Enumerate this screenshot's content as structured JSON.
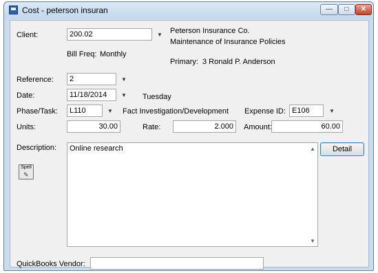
{
  "window": {
    "title": "Cost - peterson insuran",
    "min_icon": "minimize-icon",
    "max_icon": "maximize-icon",
    "close_icon": "close-icon"
  },
  "form": {
    "client_label": "Client:",
    "client_value": "200.02",
    "client_name": "Peterson Insurance Co.",
    "client_matter": "Maintenance of Insurance Policies",
    "bill_freq_label": "Bill Freq:",
    "bill_freq_value": "Monthly",
    "primary_label": "Primary:",
    "primary_value": "3  Ronald P. Anderson",
    "reference_label": "Reference:",
    "reference_value": "2",
    "date_label": "Date:",
    "date_value": "11/18/2014",
    "date_day": "Tuesday",
    "phase_label": "Phase/Task:",
    "phase_value": "L110",
    "phase_desc": "Fact Investigation/Development",
    "expense_label": "Expense ID:",
    "expense_value": "E106",
    "units_label": "Units:",
    "units_value": "30.00",
    "rate_label": "Rate:",
    "rate_value": "2.000",
    "amount_label": "Amount:",
    "amount_value": "60.00",
    "description_label": "Description:",
    "description_value": "Online research",
    "detail_button": "Detail",
    "spell_button": "Spell",
    "quickbooks_label": "QuickBooks Vendor:",
    "quickbooks_value": ""
  }
}
